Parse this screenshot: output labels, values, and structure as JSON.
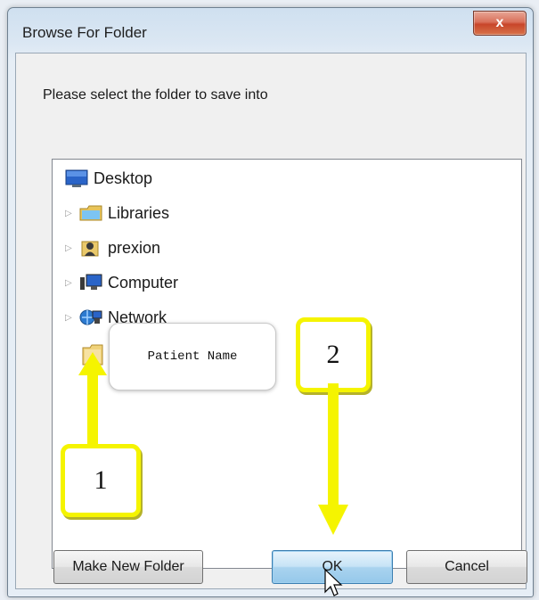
{
  "dialog": {
    "title": "Browse For Folder",
    "close_label": "x",
    "prompt": "Please select the folder to save into"
  },
  "tree": {
    "items": [
      {
        "label": "Desktop",
        "icon": "desktop-icon",
        "expandable": false
      },
      {
        "label": "Libraries",
        "icon": "libraries-icon",
        "expandable": true
      },
      {
        "label": "prexion",
        "icon": "user-folder-icon",
        "expandable": true
      },
      {
        "label": "Computer",
        "icon": "computer-icon",
        "expandable": true
      },
      {
        "label": "Network",
        "icon": "network-icon",
        "expandable": true
      }
    ],
    "folder_icon": "folder-icon"
  },
  "tooltip": {
    "text": "Patient Name"
  },
  "callouts": [
    {
      "label": "1"
    },
    {
      "label": "2"
    }
  ],
  "buttons": {
    "make_new_folder": "Make New Folder",
    "ok": "OK",
    "cancel": "Cancel"
  },
  "colors": {
    "annotation": "#f5f400",
    "close": "#c8452a",
    "ok_button": "#a9d3ef"
  }
}
